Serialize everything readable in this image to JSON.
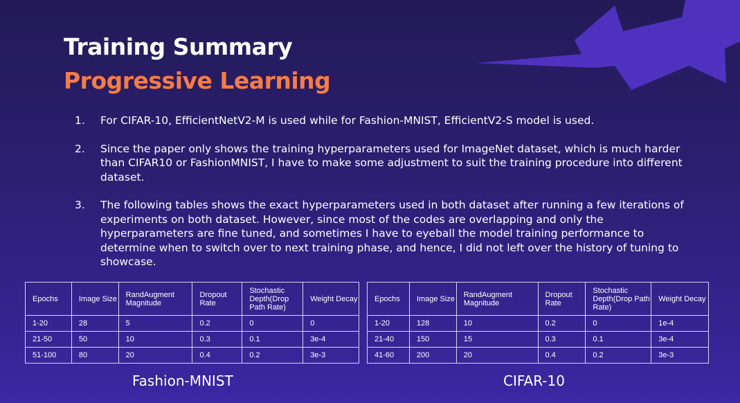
{
  "slide": {
    "title": "Training Summary",
    "subtitle": "Progressive Learning",
    "colors": {
      "title": "#ffffff",
      "accent": "#f57c45",
      "background": "#2c1f72",
      "bolt": "#5134c4"
    }
  },
  "points": [
    {
      "number": "1.",
      "text": "For CIFAR-10, EfficientNetV2-M is used while for Fashion-MNIST, EfficientV2-S model is used."
    },
    {
      "number": "2.",
      "text": "Since the paper only shows the training hyperparameters used for ImageNet dataset, which is much harder than CIFAR10 or FashionMNIST, I have to make some adjustment to suit the training procedure into different dataset."
    },
    {
      "number": "3.",
      "text": "The following tables shows the exact hyperparameters used in both dataset after running a few iterations of experiments on both dataset. However, since most of the codes are overlapping and only the hyperparameters are fine tuned, and sometimes I have to eyeball the model training performance to determine when to switch over to next training phase, and hence, I did not left over the history of tuning to showcase."
    }
  ],
  "tables": [
    {
      "caption": "Fashion-MNIST",
      "headers": [
        "Epochs",
        "Image Size",
        "RandAugment Magnitude",
        "Dropout Rate",
        "Stochastic Depth(Drop Path Rate)",
        "Weight Decay"
      ],
      "rows": [
        [
          "1-20",
          "28",
          "5",
          "0.2",
          "0",
          "0"
        ],
        [
          "21-50",
          "50",
          "10",
          "0.3",
          "0.1",
          "3e-4"
        ],
        [
          "51-100",
          "80",
          "20",
          "0.4",
          "0.2",
          "3e-3"
        ]
      ]
    },
    {
      "caption": "CIFAR-10",
      "headers": [
        "Epochs",
        "Image Size",
        "RandAugment Magnitude",
        "Dropout Rate",
        "Stochastic Depth(Drop Path Rate)",
        "Weight Decay"
      ],
      "rows": [
        [
          "1-20",
          "128",
          "10",
          "0.2",
          "0",
          "1e-4"
        ],
        [
          "21-40",
          "150",
          "15",
          "0.3",
          "0.1",
          "3e-4"
        ],
        [
          "41-60",
          "200",
          "20",
          "0.4",
          "0.2",
          "3e-3"
        ]
      ]
    }
  ]
}
